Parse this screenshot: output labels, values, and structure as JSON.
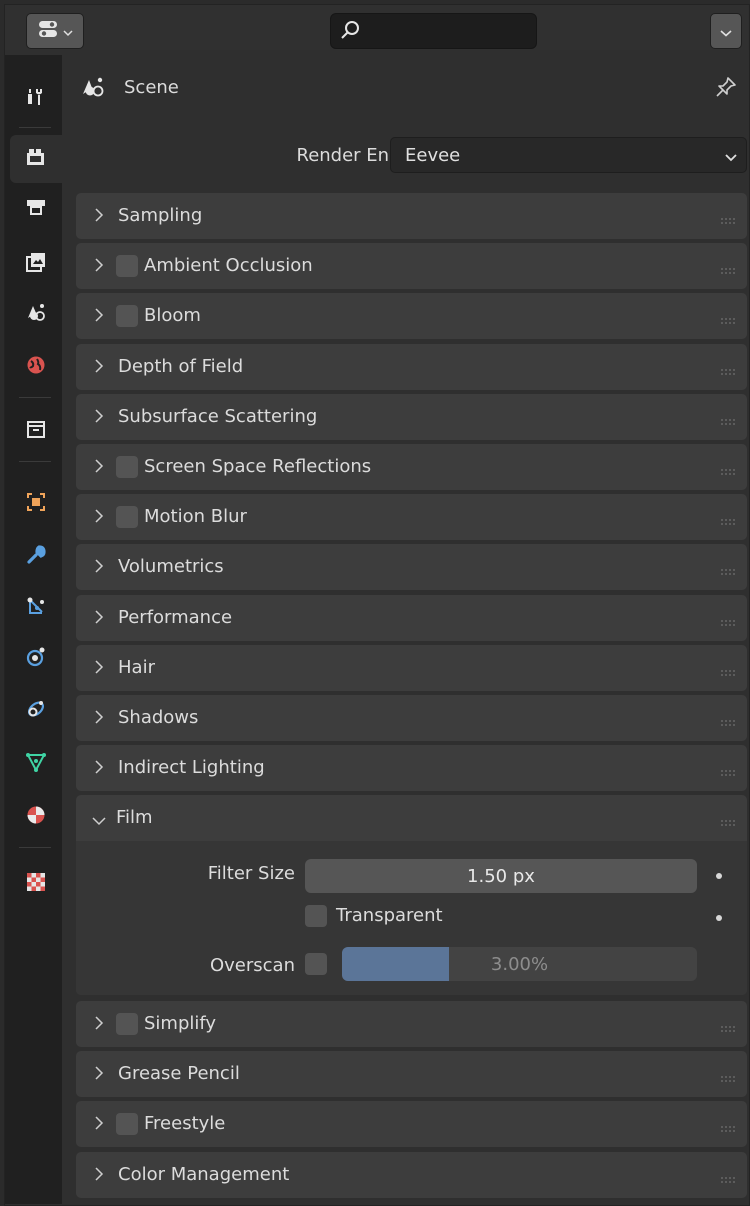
{
  "header": {
    "search_placeholder": "",
    "editor_type_icon": "properties-editor-icon",
    "options_icon": "chevron-down-icon"
  },
  "sidebar": {
    "tabs": [
      {
        "name": "tool-tab",
        "icon": "tool-icon",
        "active": false
      },
      {
        "name": "render-tab",
        "icon": "camera-back-icon",
        "active": true
      },
      {
        "name": "output-tab",
        "icon": "printer-icon",
        "active": false
      },
      {
        "name": "view-layer-tab",
        "icon": "image-layers-icon",
        "active": false
      },
      {
        "name": "scene-tab",
        "icon": "scene-icon",
        "active": false
      },
      {
        "name": "world-tab",
        "icon": "world-icon",
        "active": false
      },
      {
        "name": "collection-tab",
        "icon": "collection-box-icon",
        "active": false
      },
      {
        "name": "object-tab",
        "icon": "object-icon",
        "active": false
      },
      {
        "name": "modifiers-tab",
        "icon": "wrench-icon",
        "active": false
      },
      {
        "name": "particles-tab",
        "icon": "particles-icon",
        "active": false
      },
      {
        "name": "physics-tab",
        "icon": "physics-icon",
        "active": false
      },
      {
        "name": "constraints-tab",
        "icon": "constraint-icon",
        "active": false
      },
      {
        "name": "data-tab",
        "icon": "mesh-data-icon",
        "active": false
      },
      {
        "name": "material-tab",
        "icon": "material-icon",
        "active": false
      },
      {
        "name": "texture-tab",
        "icon": "texture-checker-icon",
        "active": false
      }
    ]
  },
  "context": {
    "label": "Scene",
    "pin_icon": "pin-icon"
  },
  "render_engine": {
    "label": "Render Engine",
    "value": "Eevee"
  },
  "panels": [
    {
      "title": "Sampling",
      "checkbox": false
    },
    {
      "title": "Ambient Occlusion",
      "checkbox": true
    },
    {
      "title": "Bloom",
      "checkbox": true
    },
    {
      "title": "Depth of Field",
      "checkbox": false
    },
    {
      "title": "Subsurface Scattering",
      "checkbox": false
    },
    {
      "title": "Screen Space Reflections",
      "checkbox": true
    },
    {
      "title": "Motion Blur",
      "checkbox": true
    },
    {
      "title": "Volumetrics",
      "checkbox": false
    },
    {
      "title": "Performance",
      "checkbox": false
    },
    {
      "title": "Hair",
      "checkbox": false
    },
    {
      "title": "Shadows",
      "checkbox": false
    },
    {
      "title": "Indirect Lighting",
      "checkbox": false
    }
  ],
  "film": {
    "title": "Film",
    "expanded": true,
    "filter_size_label": "Filter Size",
    "filter_size_value": "1.50 px",
    "transparent_label": "Transparent",
    "transparent_checked": false,
    "overscan_label": "Overscan",
    "overscan_enabled": false,
    "overscan_value": "3.00%",
    "overscan_fill_fraction": 0.3
  },
  "panels_after": [
    {
      "title": "Simplify",
      "checkbox": true
    },
    {
      "title": "Grease Pencil",
      "checkbox": false
    },
    {
      "title": "Freestyle",
      "checkbox": true
    },
    {
      "title": "Color Management",
      "checkbox": false
    }
  ],
  "colors": {
    "panel_bg": "#3d3d3d",
    "overscan_fill": "#5b7598",
    "sidebar_bg": "#202020"
  }
}
